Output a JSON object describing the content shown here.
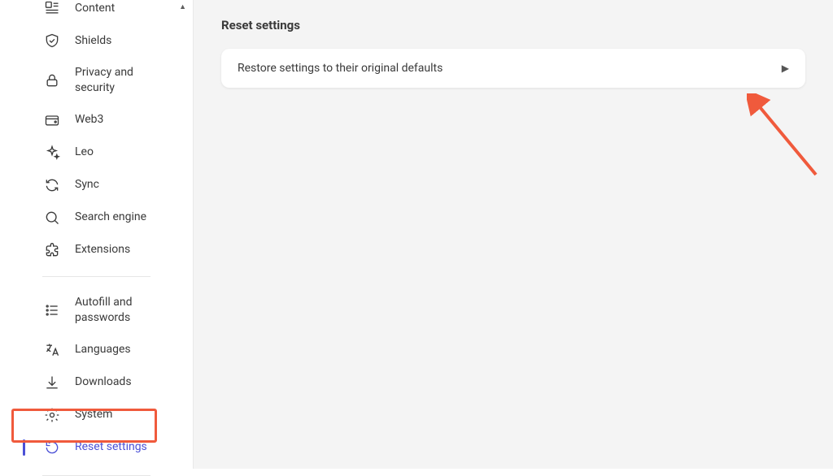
{
  "sidebar": {
    "group1": [
      {
        "icon": "content",
        "label": "Content"
      },
      {
        "icon": "shield",
        "label": "Shields"
      },
      {
        "icon": "lock",
        "label": "Privacy and security"
      },
      {
        "icon": "wallet",
        "label": "Web3"
      },
      {
        "icon": "sparkle",
        "label": "Leo"
      },
      {
        "icon": "sync",
        "label": "Sync"
      },
      {
        "icon": "search",
        "label": "Search engine"
      },
      {
        "icon": "puzzle",
        "label": "Extensions"
      }
    ],
    "group2": [
      {
        "icon": "autofill",
        "label": "Autofill and passwords"
      },
      {
        "icon": "lang",
        "label": "Languages"
      },
      {
        "icon": "download",
        "label": "Downloads"
      },
      {
        "icon": "gear",
        "label": "System"
      },
      {
        "icon": "reset",
        "label": "Reset settings",
        "active": true
      }
    ]
  },
  "main": {
    "title": "Reset settings",
    "card_label": "Restore settings to their original defaults"
  }
}
